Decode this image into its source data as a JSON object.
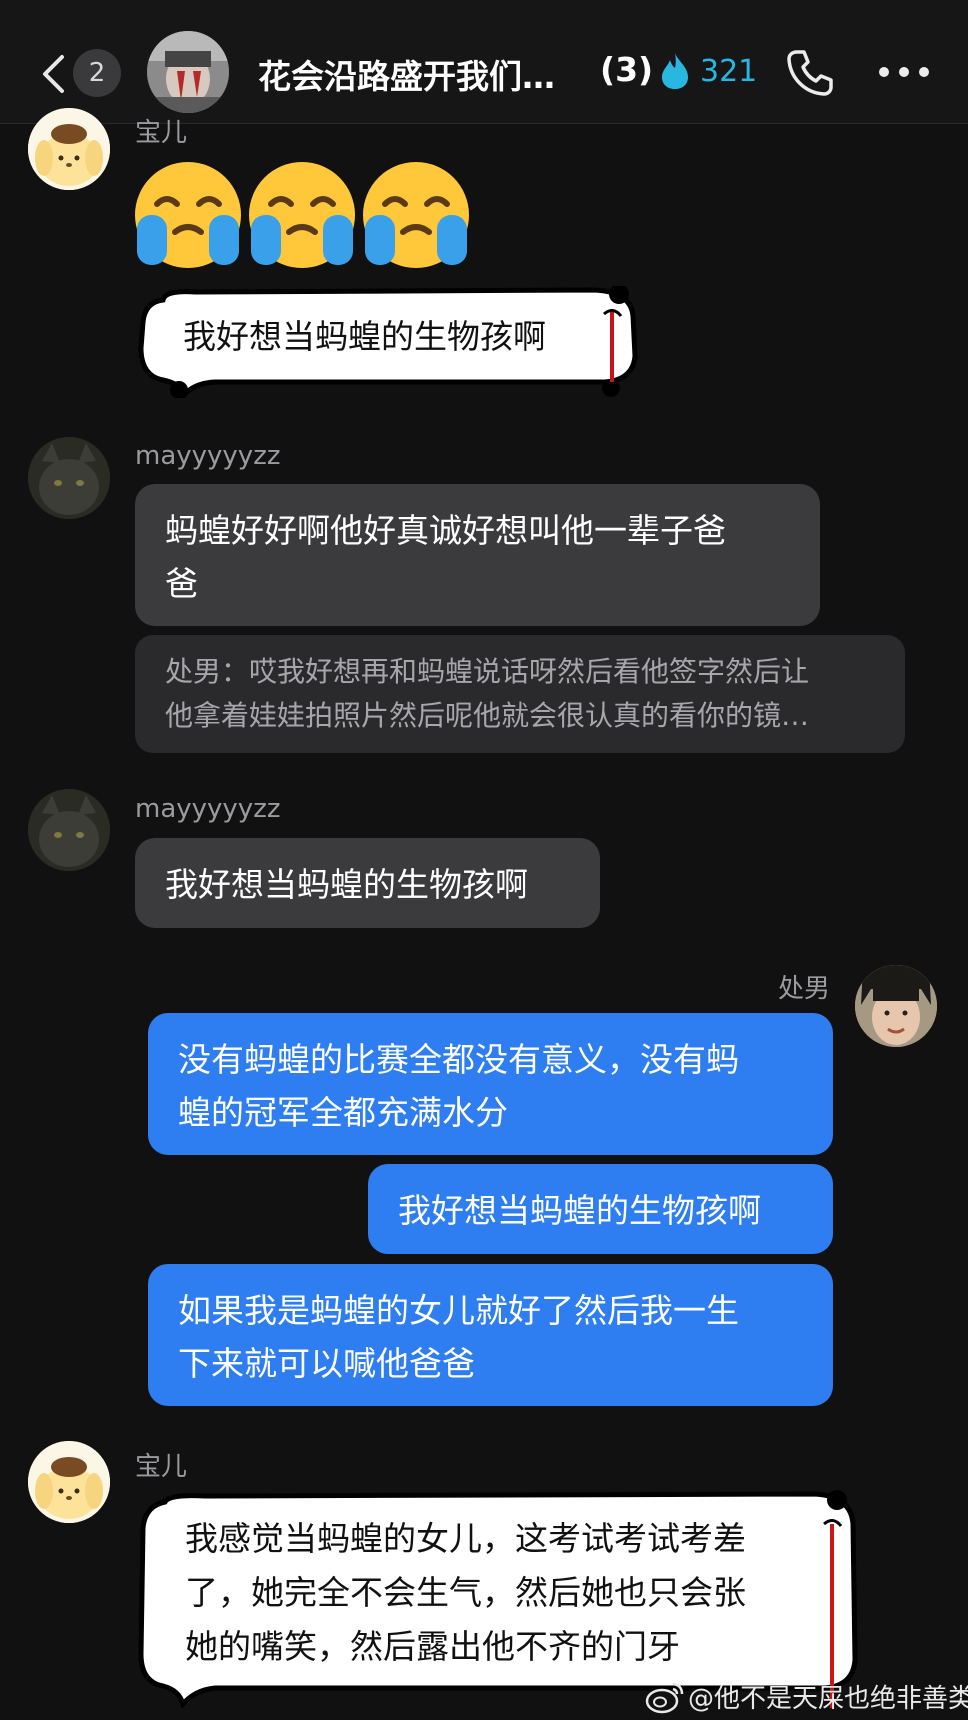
{
  "header": {
    "back_count": "2",
    "group_name": "花会沿路盛开我们…",
    "member_count": "(3)",
    "flame_count": "321",
    "icons": [
      "chevron-left-icon",
      "flame-icon",
      "phone-icon",
      "more-icon"
    ],
    "accent_color": "#28b7e0"
  },
  "messages": {
    "m1": {
      "sender": "宝儿",
      "emoji": [
        "loudly-crying-face",
        "loudly-crying-face",
        "loudly-crying-face"
      ]
    },
    "m2": {
      "sticker_text": "我好想当蚂蝗的生物孩啊"
    },
    "m3": {
      "sender": "mayyyyyzz",
      "line1": "蚂蝗好好啊他好真诚好想叫他一辈子爸",
      "line2": "爸",
      "quote_line1": "处男：哎我好想再和蚂蝗说话呀然后看他签字然后让",
      "quote_line2": "他拿着娃娃拍照片然后呢他就会很认真的看你的镜…"
    },
    "m4": {
      "sender": "mayyyyyzz",
      "text": "我好想当蚂蝗的生物孩啊"
    },
    "m5": {
      "sender": "处男",
      "line1": "没有蚂蝗的比赛全都没有意义，没有蚂",
      "line2": "蝗的冠军全都充满水分"
    },
    "m6": {
      "text": "我好想当蚂蝗的生物孩啊"
    },
    "m7": {
      "line1": "如果我是蚂蝗的女儿就好了然后我一生",
      "line2": "下来就可以喊他爸爸"
    },
    "m8": {
      "sender": "宝儿",
      "line1": "我感觉当蚂蝗的女儿，这考试考试考差",
      "line2": "了，她完全不会生气，然后她也只会张",
      "line3": "她的嘴笑，然后露出他不齐的门牙"
    }
  },
  "colors": {
    "background": "#111112",
    "bubble_other": "#3b3b3e",
    "bubble_self": "#2e7ef1"
  },
  "watermark": "@他不是天屎也绝非善类"
}
